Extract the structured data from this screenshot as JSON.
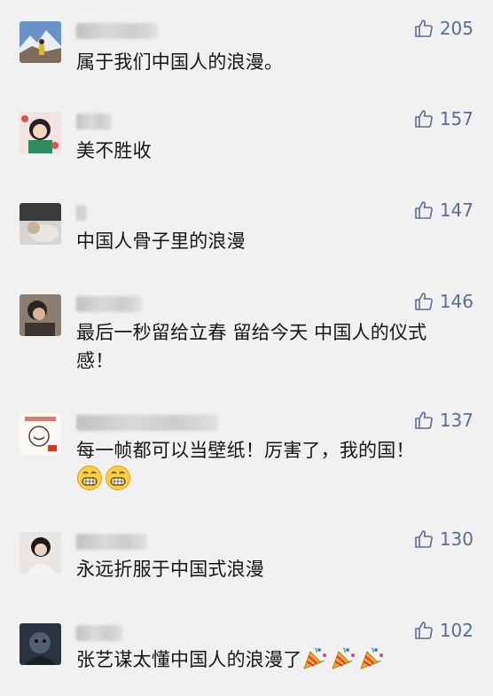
{
  "comments": [
    {
      "text": "属于我们中国人的浪漫。",
      "likes": "205",
      "avatar": "mountain-person-avatar"
    },
    {
      "text": "美不胜收",
      "likes": "157",
      "avatar": "cartoon-avatar"
    },
    {
      "text": "中国人骨子里的浪漫",
      "likes": "147",
      "avatar": "photo-avatar"
    },
    {
      "text": "最后一秒留给立春 留给今天 中国人的仪式",
      "text2": "感！",
      "likes": "146",
      "avatar": "person-avatar"
    },
    {
      "text": "每一帧都可以当壁纸！厉害了，我的国！",
      "likes": "137",
      "avatar": "sticker-avatar",
      "emojis": [
        "grinning-face",
        "grinning-face"
      ]
    },
    {
      "text": "永远折服于中国式浪漫",
      "likes": "130",
      "avatar": "woman-avatar"
    },
    {
      "text": "张艺谋太懂中国人的浪漫了",
      "likes": "102",
      "avatar": "dark-avatar",
      "emojis": [
        "party-popper",
        "party-popper",
        "party-popper"
      ]
    }
  ],
  "colors": {
    "like": "#5b6e91",
    "background": "#f1f1f1"
  }
}
